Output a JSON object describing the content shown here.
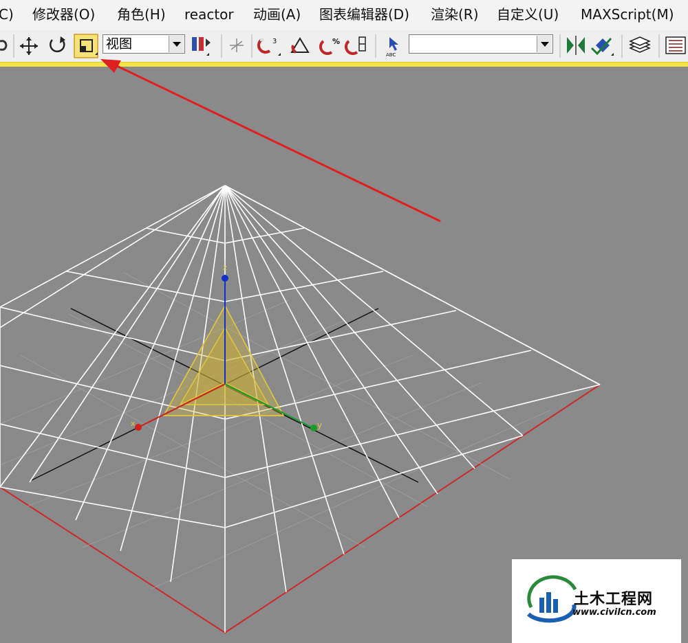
{
  "menu": {
    "items": [
      {
        "label": "C)"
      },
      {
        "label": "修改器(O)"
      },
      {
        "label": "角色(H)"
      },
      {
        "label": "reactor"
      },
      {
        "label": "动画(A)"
      },
      {
        "label": "图表编辑器(D)"
      },
      {
        "label": "渲染(R)"
      },
      {
        "label": "自定义(U)"
      },
      {
        "label": "MAXScript(M)"
      }
    ]
  },
  "toolbar": {
    "coord_system": "视图",
    "selection_set": "",
    "selected_tool": "select-and-scale",
    "icons": [
      "select-and-link-icon",
      "move-icon",
      "rotate-icon",
      "scale-icon",
      "pivot-icon",
      "snap-toggle-icon",
      "angle-snap-icon",
      "percent-snap-icon",
      "spinner-snap-icon",
      "edit-named-selection-icon",
      "mirror-icon",
      "align-icon",
      "layer-manager-icon",
      "curve-editor-icon"
    ]
  },
  "viewport": {
    "gizmo_axes": {
      "x": "x",
      "y": "y",
      "z": "z"
    },
    "colors": {
      "background": "#8a8a8a",
      "grid": "#ffffff",
      "selection": "#e3c83a",
      "x_axis": "#d02020",
      "y_axis": "#1a9a2a",
      "z_axis": "#1030c8",
      "annotation_arrow": "#e02020"
    }
  },
  "watermark": {
    "name": "土木工程网",
    "url": "www.civilcn.com"
  }
}
